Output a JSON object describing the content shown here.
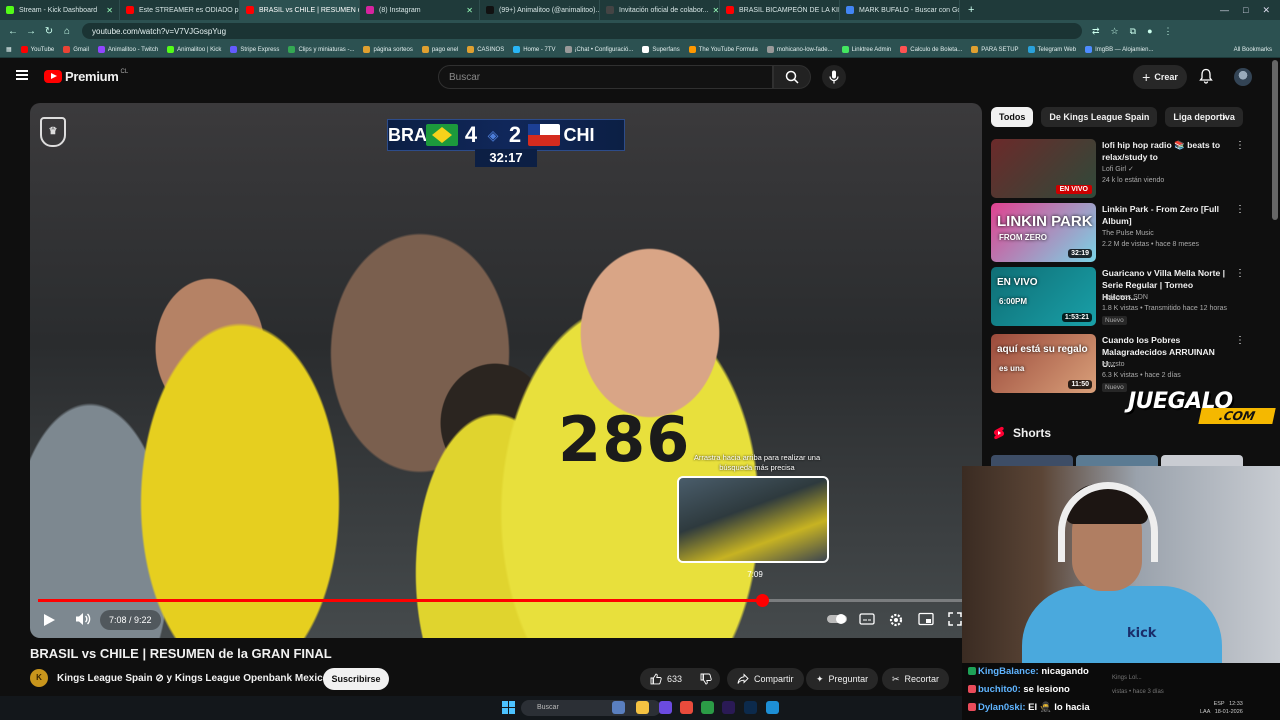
{
  "browser": {
    "tabs": [
      {
        "label": "Stream - Kick Dashboard",
        "color": "#53fc18",
        "active": false
      },
      {
        "label": "Este STREAMER es ODIADO po...",
        "color": "#ff0000",
        "active": false
      },
      {
        "label": "BRASIL vs CHILE | RESUMEN de...",
        "color": "#ff0000",
        "active": true
      },
      {
        "label": "(8) Instagram",
        "color": "#d6249f",
        "active": false
      },
      {
        "label": "(99+) Animalitoo (@animalitoo)...",
        "color": "#111111",
        "active": false
      },
      {
        "label": "Invitación oficial de colabor...",
        "color": "#444444",
        "active": false
      },
      {
        "label": "BRASIL BICAMPEÓN DE LA KIN...",
        "color": "#ff0000",
        "active": false
      },
      {
        "label": "MARK BUFALO - Buscar con Go...",
        "color": "#4285f4",
        "active": false
      }
    ],
    "new_tab": "+",
    "url": "youtube.com/watch?v=V7VJGospYug",
    "bookmarks": [
      {
        "label": "YouTube",
        "color": "#ff0000"
      },
      {
        "label": "Gmail",
        "color": "#ea4335"
      },
      {
        "label": "Animalitoo - Twitch",
        "color": "#9146ff"
      },
      {
        "label": "Animalitoo | Kick",
        "color": "#53fc18"
      },
      {
        "label": "Stripe Express",
        "color": "#635bff"
      },
      {
        "label": "Clips y miniaturas -...",
        "color": "#34a853"
      },
      {
        "label": "página sorteos",
        "color": "#e0a030"
      },
      {
        "label": "pago enel",
        "color": "#e0a030"
      },
      {
        "label": "CASINOS",
        "color": "#e0a030"
      },
      {
        "label": "Home - 7TV",
        "color": "#29b6f6"
      },
      {
        "label": "¡Chat • Configuració...",
        "color": "#999999"
      },
      {
        "label": "Superfans",
        "color": "#ffffff"
      },
      {
        "label": "The YouTube Formula",
        "color": "#ff9800"
      },
      {
        "label": "mohicano-low-fade...",
        "color": "#999999"
      },
      {
        "label": "Linktree Admin",
        "color": "#43e660"
      },
      {
        "label": "Calculo de Boleta...",
        "color": "#ff5252"
      },
      {
        "label": "PARA SETUP",
        "color": "#e0a030"
      },
      {
        "label": "Telegram Web",
        "color": "#2aa1da"
      },
      {
        "label": "ImgBB — Alojamien...",
        "color": "#4e8cff"
      }
    ],
    "all_bookmarks": "All Bookmarks"
  },
  "youtube": {
    "logo_text": "Premium",
    "country_code": "CL",
    "search_placeholder": "Buscar",
    "create_label": "Crear"
  },
  "player": {
    "scoreboard": {
      "home": "BRA",
      "away": "CHI",
      "home_score": "4",
      "away_score": "2",
      "clock": "32:17"
    },
    "jersey_number": "286",
    "preview_hint": "Arrastra hacia arriba para realizar una búsqueda más precisa",
    "preview_time": "7:09",
    "time_display": "7:08 / 9:22",
    "progress_fraction": 0.773
  },
  "video": {
    "title": "BRASIL vs CHILE | RESUMEN de la GRAN FINAL",
    "channel_initial": "K",
    "channel": "Kings League Spain ⊘ y Kings League Openbank Mexico",
    "subscribe": "Suscribirse",
    "likes": "633",
    "share": "Compartir",
    "ask": "Preguntar",
    "clip": "Recortar"
  },
  "sidebar": {
    "chips": [
      "Todos",
      "De Kings League Spain",
      "Liga deportiva"
    ],
    "recommendations": [
      {
        "title": "lofi hip hop radio 📚 beats to relax/study to",
        "channel": "Lofi Girl ✓",
        "stats": "24 k lo están viendo",
        "badge": "EN VIVO",
        "badge_type": "live",
        "thumb_text": "",
        "colors": [
          "#6b2a2a",
          "#2f4a3a"
        ]
      },
      {
        "title": "Linkin Park - From Zero [Full Album]",
        "channel": "The Pulse Music",
        "stats": "2.2 M de vistas • hace 8 meses",
        "badge": "32:19",
        "badge_type": "duration",
        "thumb_text": "LINKIN PARK",
        "thumb_sub": "FROM ZERO",
        "colors": [
          "#e0418f",
          "#7ad4e6"
        ]
      },
      {
        "title": "Guaricano v Villa Mella Norte | Serie Regular | Torneo Halcon...",
        "channel": "Halcones SDN",
        "stats": "1.8 K vistas • Transmitido hace 12 horas",
        "badge": "1:53:21",
        "badge_type": "duration",
        "new": "Nuevo",
        "thumb_text": "EN VIVO",
        "thumb_sub": "6:00PM",
        "colors": [
          "#0f6e75",
          "#19a0a8"
        ]
      },
      {
        "title": "Cuando los Pobres Malagradecidos ARRUINAN U...",
        "channel": "emzsto",
        "stats": "6.3 K vistas • hace 2 días",
        "badge": "11:50",
        "badge_type": "duration",
        "new": "Nuevo",
        "thumb_text": "aquí está su regalo",
        "thumb_sub": "es una",
        "colors": [
          "#9b4a3b",
          "#d9a07a"
        ]
      }
    ],
    "sponsor_main": "JUEGALO",
    "sponsor_suffix": ".COM",
    "shorts_label": "Shorts"
  },
  "chat": {
    "lines": [
      {
        "user": "KingBalance:",
        "msg": "nicagando"
      },
      {
        "user": "buchito0:",
        "msg": "se lesiono"
      },
      {
        "user": "Dylan0ski:",
        "msg": "El 🥷 lo hacia"
      }
    ],
    "ghost_text": "Kings Lol...",
    "ghost_meta": "vistas • hace 3 días"
  },
  "taskbar": {
    "search_placeholder": "Buscar",
    "lang": "ESP",
    "lang_sub": "LAA",
    "time": "12:33",
    "date": "18-01-2026"
  }
}
